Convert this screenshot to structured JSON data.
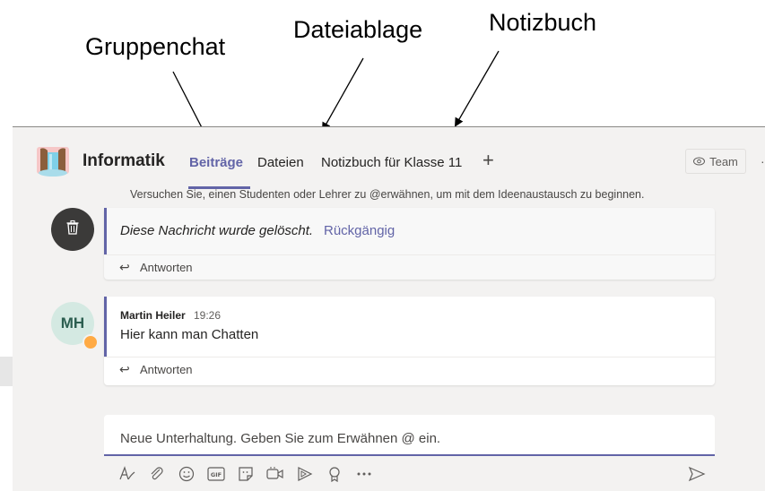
{
  "annotations": {
    "gruppenchat": "Gruppenchat",
    "dateiablage": "Dateiablage",
    "notizbuch": "Notizbuch"
  },
  "header": {
    "team_name": "Informatik",
    "logo_icon": "team-logo-icon",
    "tabs": [
      {
        "label": "Beiträge",
        "active": true
      },
      {
        "label": "Dateien",
        "active": false
      },
      {
        "label": "Notizbuch für Klasse 11",
        "active": false
      }
    ],
    "add_tab": "+",
    "team_button": "Team",
    "accent": "#6264a7"
  },
  "feed": {
    "hint": "Versuchen Sie, einen Studenten oder Lehrer zu @erwähnen, um mit dem Ideenaustausch zu beginnen.",
    "deleted_post": {
      "avatar_icon": "trash-icon",
      "text": "Diese Nachricht wurde gelöscht.",
      "undo": "Rückgängig",
      "reply": "Antworten"
    },
    "post": {
      "avatar_initials": "MH",
      "status": "away",
      "sender": "Martin Heiler",
      "time": "19:26",
      "text": "Hier kann man Chatten",
      "reply": "Antworten"
    }
  },
  "composer": {
    "placeholder": "Neue Unterhaltung. Geben Sie zum Erwähnen @ ein.",
    "toolbar": [
      "format-icon",
      "attach-icon",
      "emoji-icon",
      "gif-icon",
      "sticker-icon",
      "meet-now-icon",
      "stream-icon",
      "praise-icon",
      "more-options-icon",
      "send-icon"
    ]
  }
}
